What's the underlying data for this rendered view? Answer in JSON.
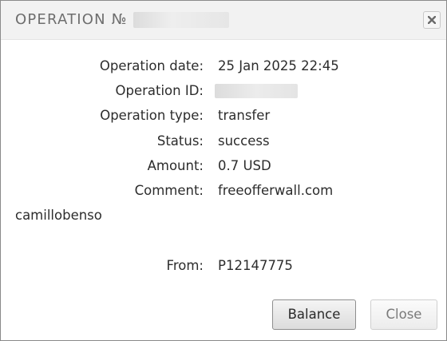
{
  "dialog": {
    "title": "OPERATION №",
    "close_icon": "close-x-icon"
  },
  "details": {
    "operation_date_label": "Operation date:",
    "operation_date_value": "25 Jan 2025 22:45",
    "operation_id_label": "Operation ID:",
    "operation_type_label": "Operation type:",
    "operation_type_value": "transfer",
    "status_label": "Status:",
    "status_value": "success",
    "amount_label": "Amount:",
    "amount_value": "0.7 USD",
    "comment_label": "Comment:",
    "comment_value": "freeofferwall.com",
    "comment_continuation": "camillobenso",
    "from_label": "From:",
    "from_value": "P12147775"
  },
  "buttons": {
    "balance_label": "Balance",
    "close_label": "Close"
  }
}
